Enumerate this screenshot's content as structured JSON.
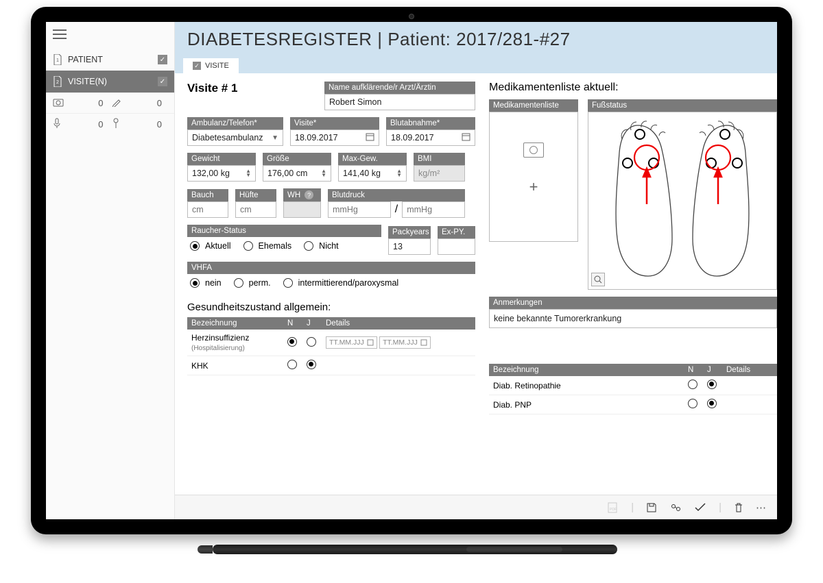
{
  "header": {
    "app_title": "DIABETESREGISTER",
    "separator": " | ",
    "patient_prefix": "Patient: ",
    "patient_id": "2017/281-#27"
  },
  "sidebar": {
    "items": [
      {
        "label": "PATIENT",
        "checked": true,
        "active": false
      },
      {
        "label": "VISITE(N)",
        "checked": true,
        "active": true
      }
    ],
    "tools": {
      "camera_count": "0",
      "pencil_count": "0",
      "mic_count": "0",
      "pin_count": "0"
    }
  },
  "tab": {
    "label": "VISITE"
  },
  "visit": {
    "title": "Visite # 1",
    "doctor_label": "Name aufklärende/r Arzt/Ärztin",
    "doctor_value": "Robert Simon",
    "ambulanz_label": "Ambulanz/Telefon*",
    "ambulanz_value": "Diabetesambulanz",
    "visite_label": "Visite*",
    "visite_value": "18.09.2017",
    "blut_label": "Blutabnahme*",
    "blut_value": "18.09.2017",
    "gewicht_label": "Gewicht",
    "gewicht_value": "132,00 kg",
    "groesse_label": "Größe",
    "groesse_value": "176,00 cm",
    "maxgew_label": "Max-Gew.",
    "maxgew_value": "141,40 kg",
    "bmi_label": "BMI",
    "bmi_value": "kg/m²",
    "bauch_label": "Bauch",
    "bauch_ph": "cm",
    "huefte_label": "Hüfte",
    "huefte_ph": "cm",
    "wh_label": "WH",
    "blutdruck_label": "Blutdruck",
    "bp_ph": "mmHg",
    "bp_sep": "/",
    "raucher_label": "Raucher-Status",
    "raucher_options": [
      "Aktuell",
      "Ehemals",
      "Nicht"
    ],
    "packyears_label": "Packyears",
    "packyears_value": "13",
    "expy_label": "Ex-PY.",
    "vhfa_label": "VHFA",
    "vhfa_options": [
      "nein",
      "perm.",
      "intermittierend/paroxysmal"
    ]
  },
  "right": {
    "med_title": "Medikamentenliste aktuell:",
    "med_label": "Medikamentenliste",
    "fuss_label": "Fußstatus",
    "anm_label": "Anmerkungen",
    "anm_value": "keine bekannte Tumorerkrankung"
  },
  "health": {
    "title": "Gesundheitszustand allgemein:",
    "cols": {
      "bez": "Bezeichnung",
      "n": "N",
      "j": "J",
      "det": "Details"
    },
    "date_ph": "TT.MM.JJJ",
    "left_rows": [
      {
        "name": "Herzinsuffizienz",
        "sub": "(Hospitalisierung)",
        "n": true,
        "j": false,
        "dates": true
      },
      {
        "name": "KHK",
        "sub": "",
        "n": false,
        "j": true,
        "dates": false
      }
    ],
    "right_rows": [
      {
        "name": "Diab. Retinopathie",
        "n": false,
        "j": true
      },
      {
        "name": "Diab. PNP",
        "n": false,
        "j": true
      }
    ]
  }
}
